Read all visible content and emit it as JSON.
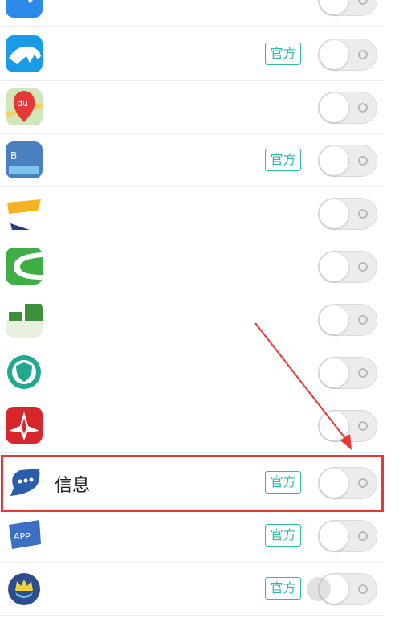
{
  "badge_label": "官方",
  "highlight_color": "#e53935",
  "accent_color": "#2fb9a9",
  "apps": [
    {
      "name": "",
      "official": false,
      "enabled": false,
      "icon": "blue-app-icon"
    },
    {
      "name": "",
      "official": true,
      "enabled": false,
      "icon": "blue-animal-app-icon"
    },
    {
      "name": "",
      "official": false,
      "enabled": false,
      "icon": "baidu-map-icon"
    },
    {
      "name": "",
      "official": true,
      "enabled": false,
      "icon": "book-app-icon"
    },
    {
      "name": "",
      "official": false,
      "enabled": false,
      "icon": "game-app-icon"
    },
    {
      "name": "",
      "official": false,
      "enabled": false,
      "icon": "green-app-icon"
    },
    {
      "name": "",
      "official": false,
      "enabled": false,
      "icon": "green-text-app-icon"
    },
    {
      "name": "",
      "official": false,
      "enabled": false,
      "icon": "security-shield-app-icon"
    },
    {
      "name": "",
      "official": false,
      "enabled": false,
      "icon": "red-star-app-icon"
    },
    {
      "name": "信息",
      "official": true,
      "enabled": false,
      "icon": "message-bubble-icon"
    },
    {
      "name": "",
      "official": true,
      "enabled": false,
      "icon": "app-store-icon"
    },
    {
      "name": "",
      "official": true,
      "enabled": false,
      "icon": "crown-app-icon"
    }
  ]
}
